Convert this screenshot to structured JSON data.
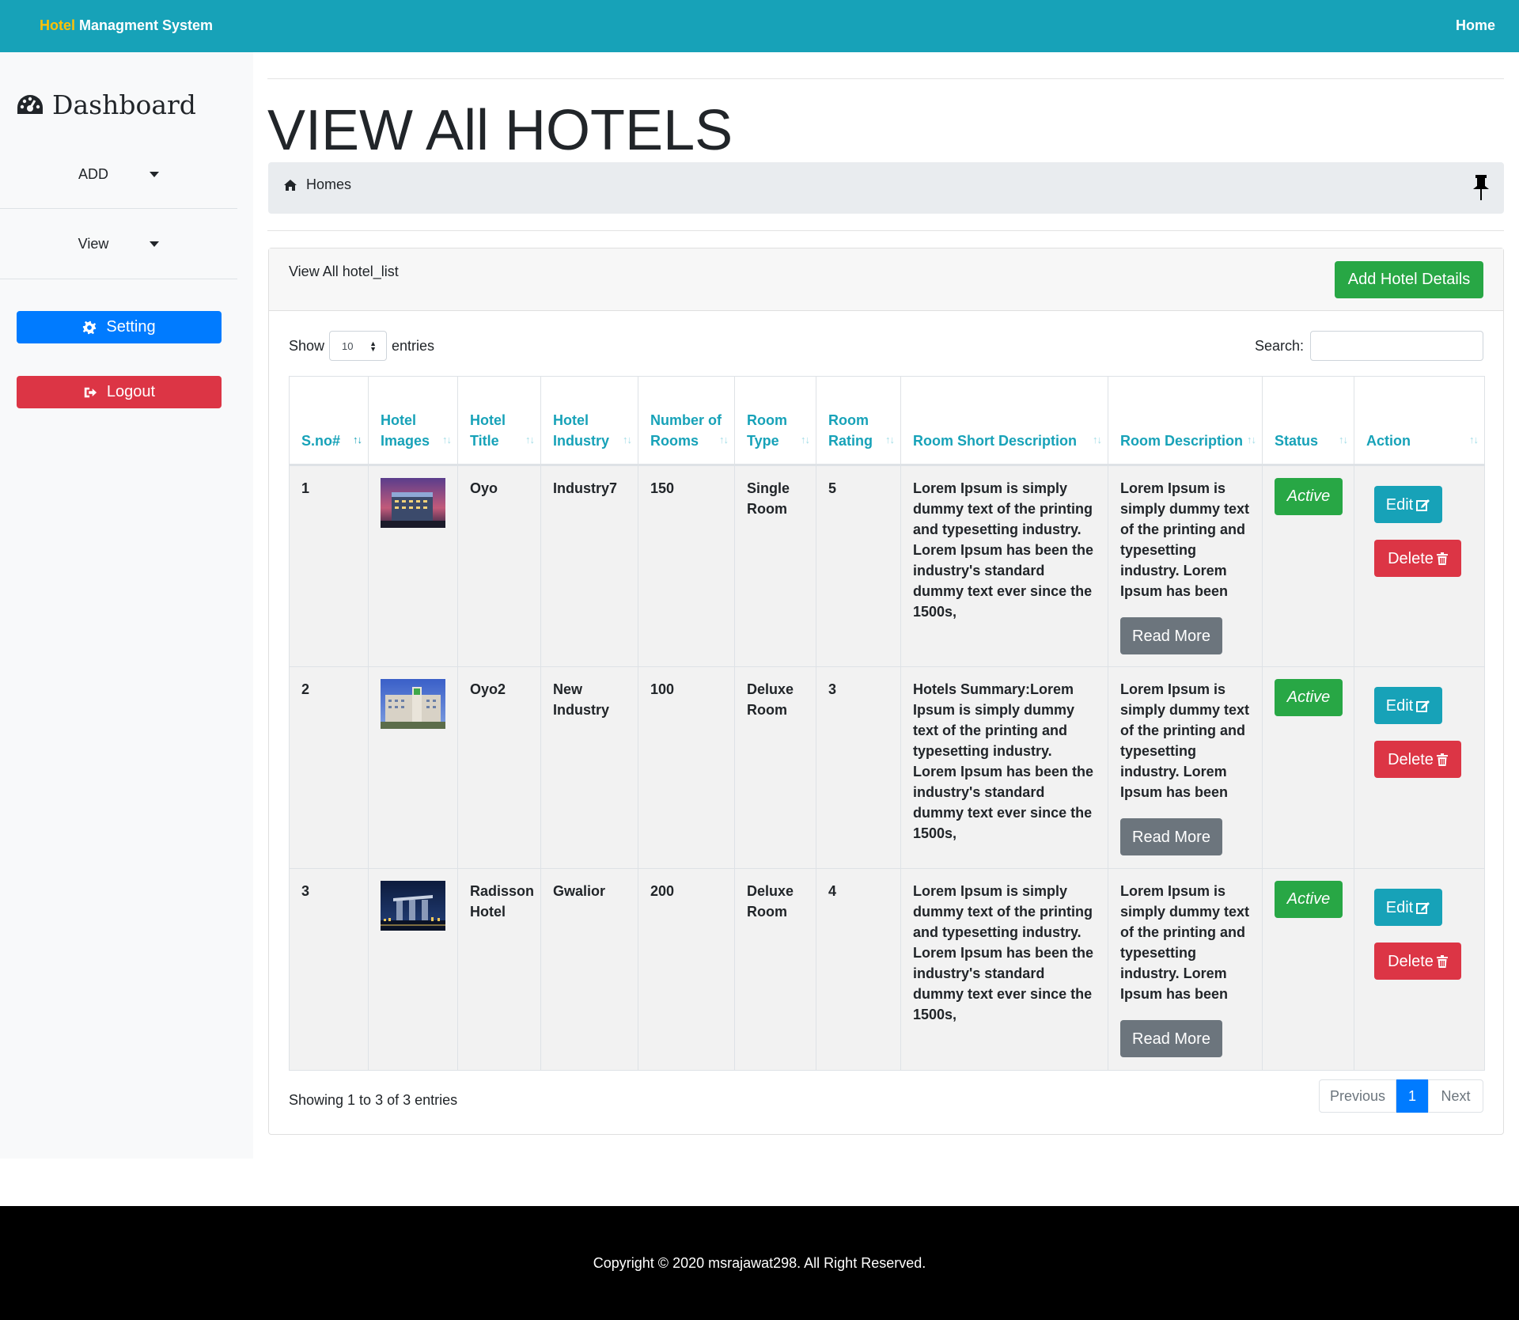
{
  "navbar": {
    "brand_accent": "Hotel",
    "brand_rest": " Managment System",
    "home": "Home"
  },
  "sidebar": {
    "title": "Dashboard",
    "dropdowns": [
      {
        "label": "ADD"
      },
      {
        "label": "View"
      }
    ],
    "setting": "Setting",
    "logout": "Logout"
  },
  "page": {
    "title": "VIEW All HOTELS",
    "breadcrumb": "Homes"
  },
  "card": {
    "title": "View All hotel_list",
    "add_button": "Add Hotel Details",
    "show_label": "Show",
    "entries_value": "10",
    "entries_label": "entries",
    "search_label": "Search:",
    "search_value": "",
    "info": "Showing 1 to 3 of 3 entries",
    "pagination": {
      "prev": "Previous",
      "page": "1",
      "next": "Next"
    }
  },
  "table": {
    "headers": [
      "S.no#",
      "Hotel Images",
      "Hotel Title",
      "Hotel Industry",
      "Number of Rooms",
      "Room Type",
      "Room Rating",
      "Room Short Description",
      "Room Description",
      "Status",
      "Action"
    ],
    "rows": [
      {
        "sno": "1",
        "title": "Oyo",
        "industry": "Industry7",
        "rooms": "150",
        "type": "Single Room",
        "rating": "5",
        "short": "Lorem Ipsum is simply dummy text of the printing and typesetting industry. Lorem Ipsum has been the industry's standard dummy text ever since the 1500s,",
        "desc": "Lorem Ipsum is simply dummy text of the printing and typesetting industry. Lorem Ipsum has been the",
        "read_more": "Read More",
        "status": "Active",
        "edit": "Edit",
        "delete": "Delete"
      },
      {
        "sno": "2",
        "title": "Oyo2",
        "industry": "New Industry",
        "rooms": "100",
        "type": "Deluxe Room",
        "rating": "3",
        "short": "Hotels Summary:Lorem Ipsum is simply dummy text of the printing and typesetting industry. Lorem Ipsum has been the industry's standard dummy text ever since the 1500s,",
        "desc": "Lorem Ipsum is simply dummy text of the printing and typesetting industry. Lorem Ipsum has been the",
        "read_more": "Read More",
        "status": "Active",
        "edit": "Edit",
        "delete": "Delete"
      },
      {
        "sno": "3",
        "title": "Radisson Hotel",
        "industry": "Gwalior",
        "rooms": "200",
        "type": "Deluxe Room",
        "rating": "4",
        "short": "Lorem Ipsum is simply dummy text of the printing and typesetting industry. Lorem Ipsum has been the industry's standard dummy text ever since the 1500s,",
        "desc": "Lorem Ipsum is simply dummy text of the printing and typesetting industry. Lorem Ipsum has been the",
        "read_more": "Read More",
        "status": "Active",
        "edit": "Edit",
        "delete": "Delete"
      }
    ]
  },
  "footer": {
    "text": "Copyright © 2020 msrajawat298. All Right Reserved."
  },
  "colors": {
    "navbar": "#17a2b8",
    "brand_accent": "#ffc107",
    "primary": "#007bff",
    "danger": "#dc3545",
    "success": "#28a745",
    "secondary": "#6c757d"
  },
  "icons": [
    "dashboard-icon",
    "caret-down-icon",
    "gear-icon",
    "sign-out-icon",
    "home-icon",
    "pin-icon",
    "sort-icon",
    "edit-icon",
    "trash-icon"
  ]
}
